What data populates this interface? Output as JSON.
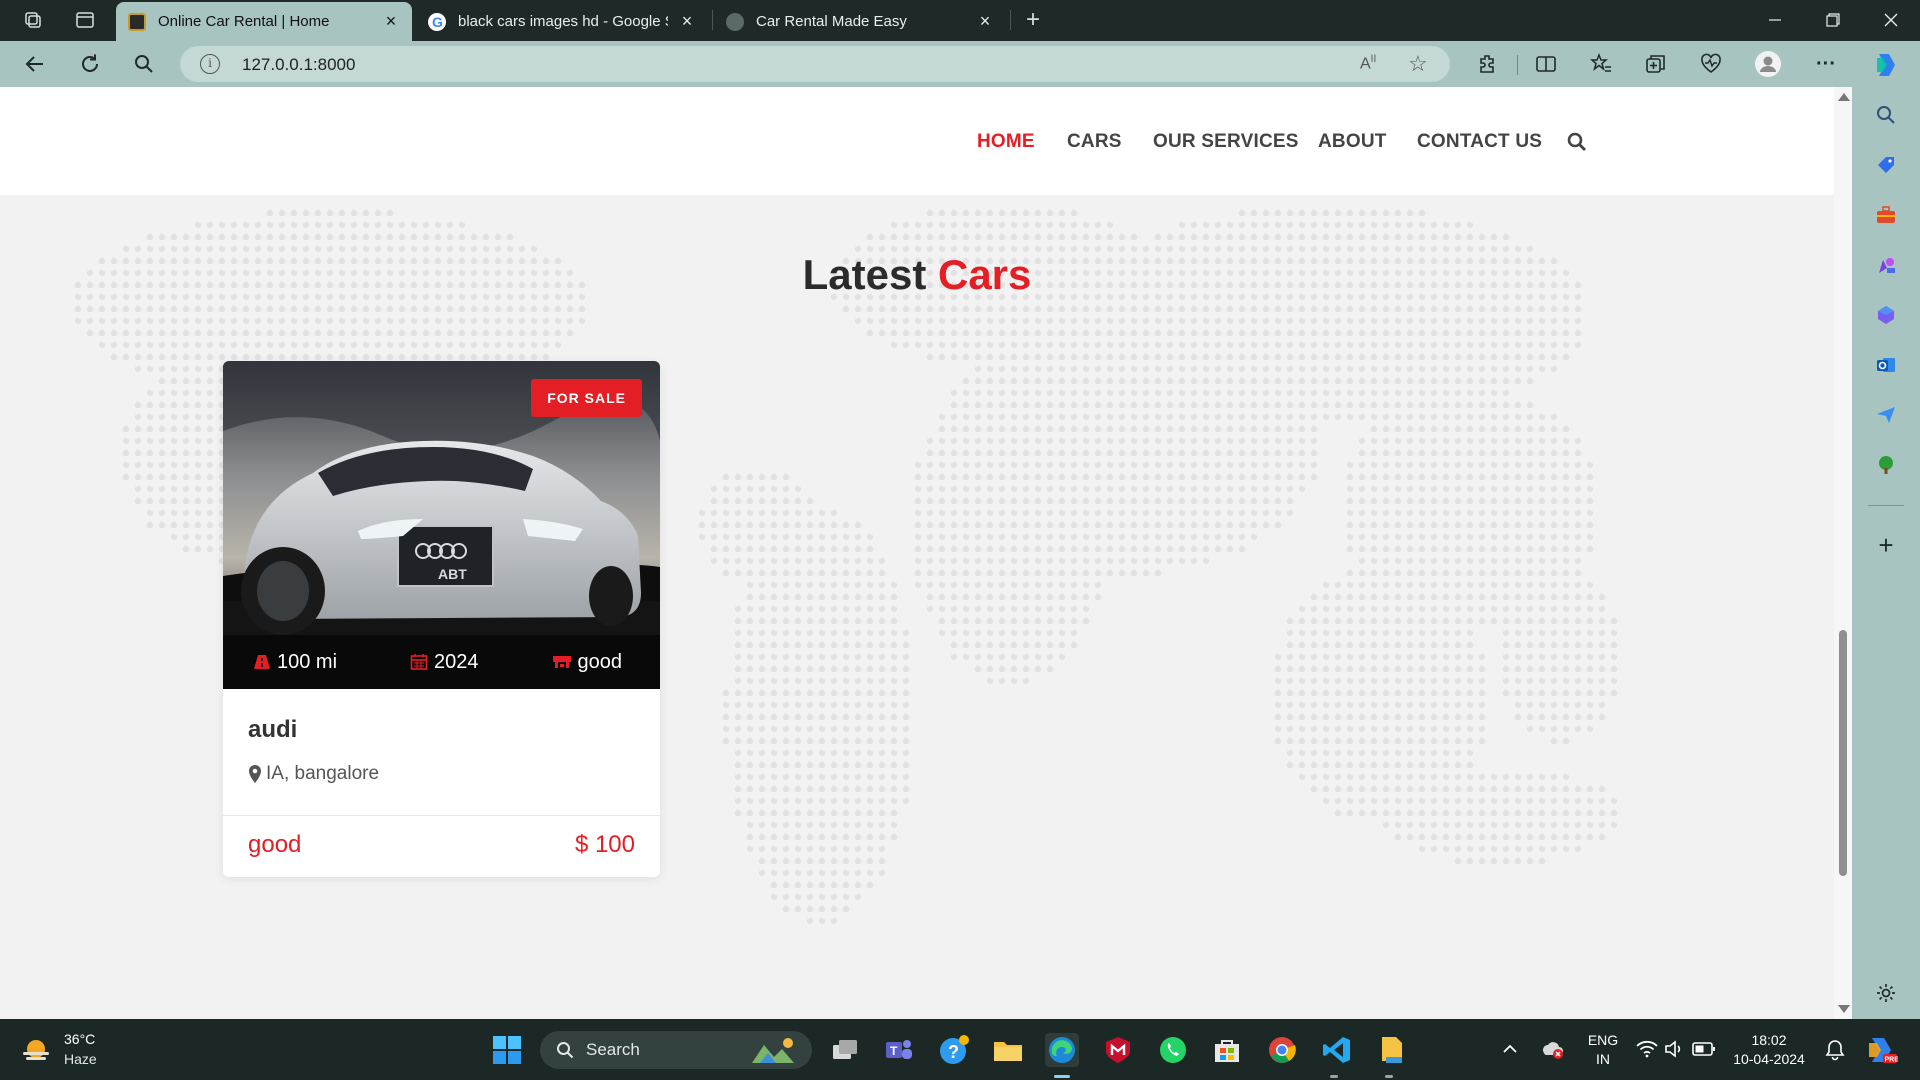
{
  "browser": {
    "tabs": [
      {
        "title": "Online Car Rental | Home",
        "active": true
      },
      {
        "title": "black cars images hd - Google Se",
        "active": false
      },
      {
        "title": "Car Rental Made Easy",
        "active": false
      }
    ],
    "address": "127.0.0.1:8000"
  },
  "nav": {
    "items": [
      "HOME",
      "CARS",
      "OUR SERVICES",
      "ABOUT",
      "CONTACT US"
    ],
    "active": "HOME"
  },
  "section": {
    "title_main": "Latest",
    "title_accent": "Cars"
  },
  "cars": [
    {
      "badge": "FOR SALE",
      "mileage": "100 mi",
      "year": "2024",
      "condition_spec": "good",
      "name": "audi",
      "location": "IA, bangalore",
      "condition": "good",
      "price": "$ 100"
    }
  ],
  "taskbar": {
    "weather_temp": "36°C",
    "weather_cond": "Haze",
    "search_label": "Search",
    "lang_top": "ENG",
    "lang_bottom": "IN",
    "time": "18:02",
    "date": "10-04-2024"
  },
  "colors": {
    "accent": "#e31e24",
    "browser_chrome": "#a8c4c0",
    "taskbar": "#1c2826"
  }
}
